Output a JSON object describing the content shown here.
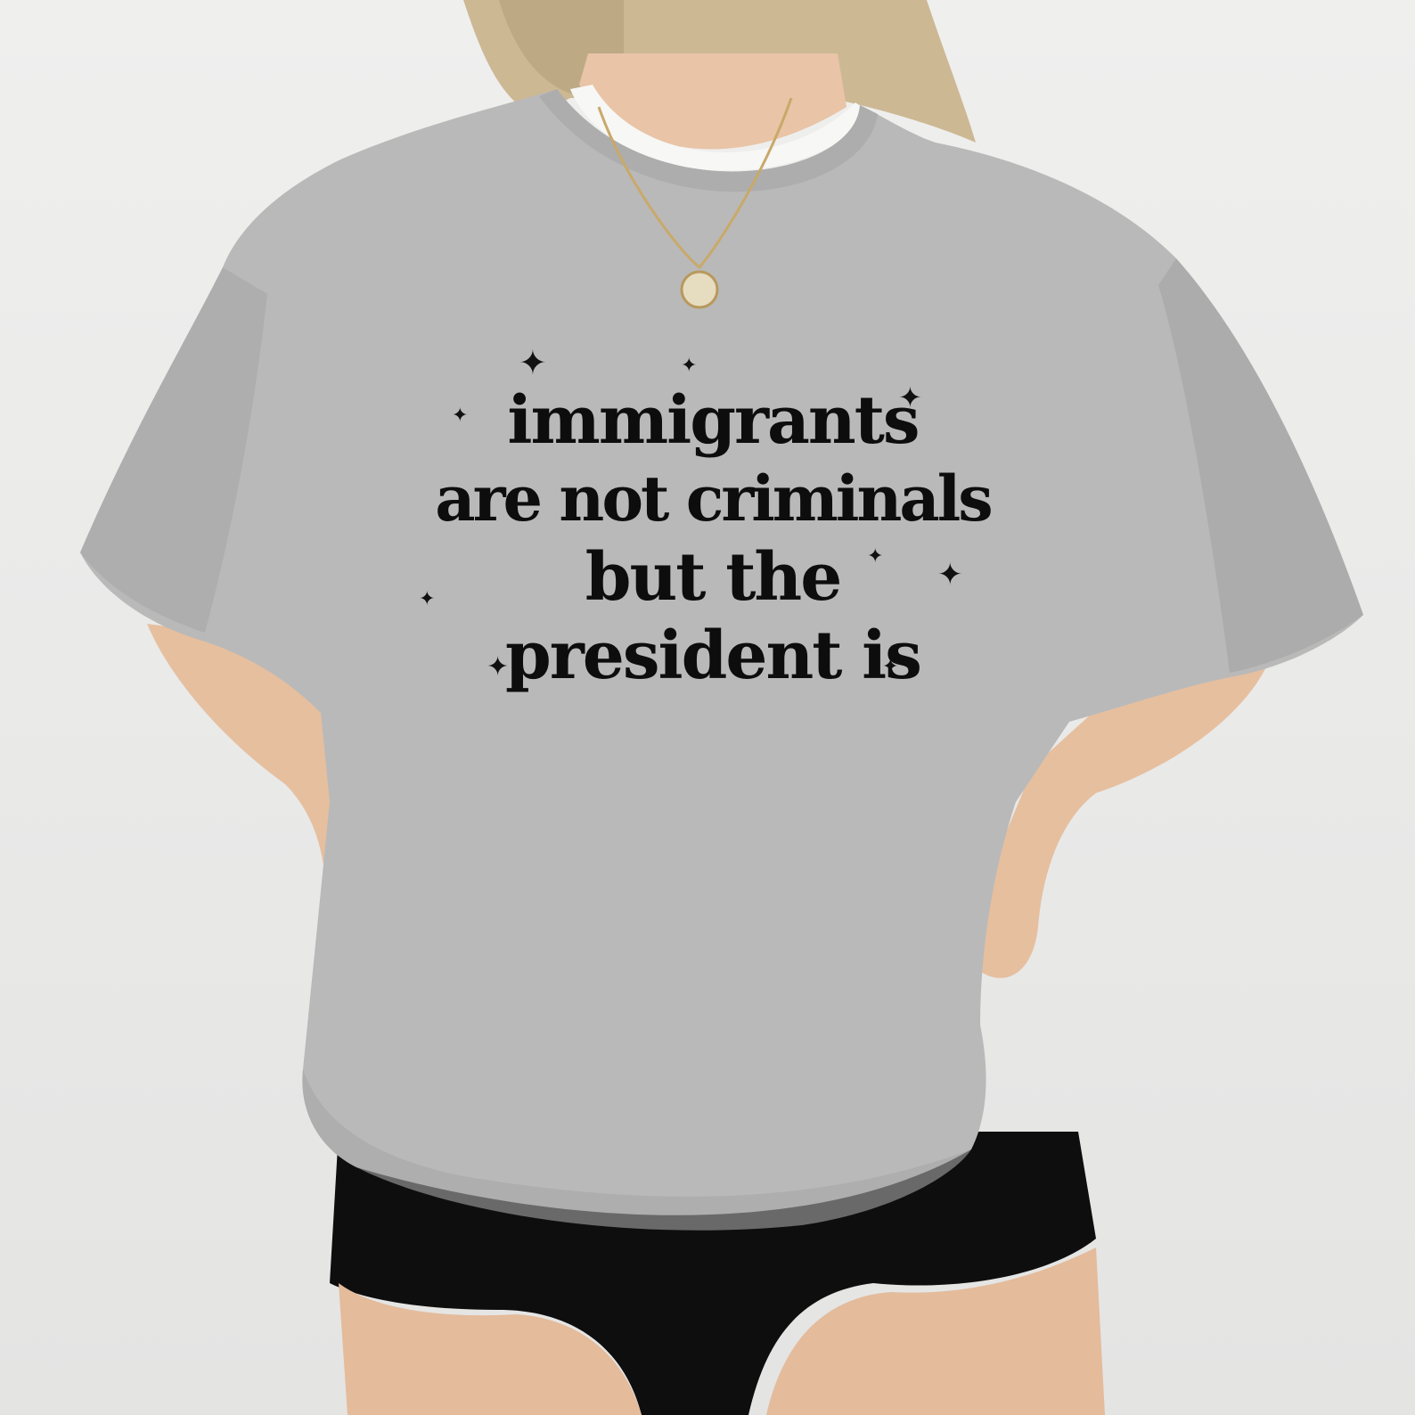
{
  "photo": {
    "shirt_color": "#b9b9b9",
    "background_color": "#ececeb",
    "shorts_color": "#0e0e0e",
    "skin_color": "#e8c2a4",
    "hair_color": "#c8b28e"
  },
  "shirt_print": {
    "lines": [
      "immigrants",
      "are not criminals",
      "but the",
      "president is"
    ],
    "text_color": "#0d0d0d",
    "decoration_icon": "four-point-sparkle-icon"
  }
}
